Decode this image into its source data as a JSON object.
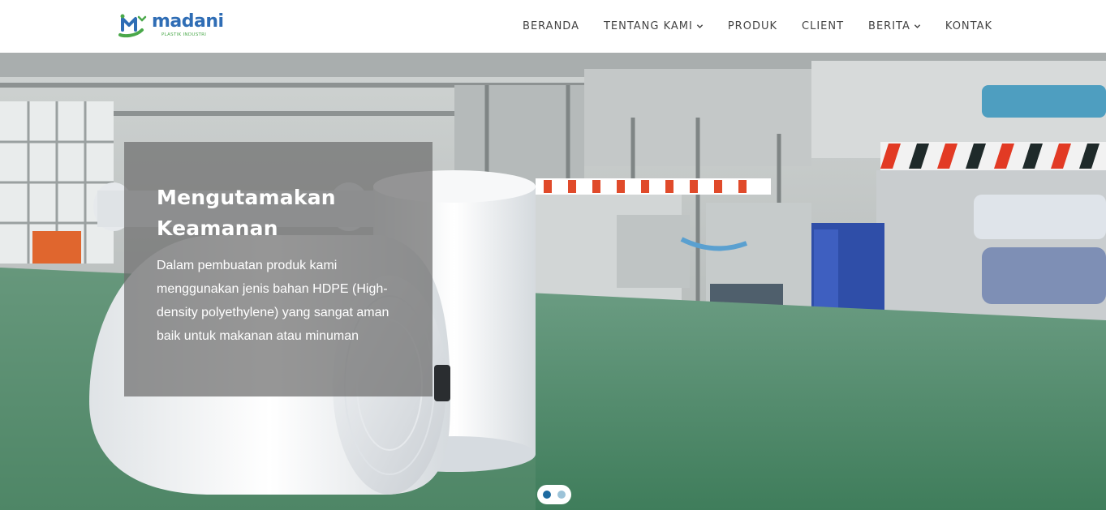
{
  "brand": {
    "name": "madani",
    "tagline": "PLASTIK INDUSTRI",
    "logo_icon": "madani-m-logo-icon",
    "colors": {
      "blue": "#2f6db5",
      "green": "#4aa84a"
    }
  },
  "nav": {
    "items": [
      {
        "label": "BERANDA",
        "dropdown": false
      },
      {
        "label": "TENTANG KAMI",
        "dropdown": true
      },
      {
        "label": "PRODUK",
        "dropdown": false
      },
      {
        "label": "CLIENT",
        "dropdown": false
      },
      {
        "label": "BERITA",
        "dropdown": true
      },
      {
        "label": "KONTAK",
        "dropdown": false
      }
    ]
  },
  "hero": {
    "slide": {
      "title_line1": "Mengutamakan",
      "title_line2": "Keamanan",
      "text": "Dalam pembuatan produk kami menggunakan jenis bahan HDPE (High-density polyethylene) yang sangat aman baik untuk makanan atau minuman"
    },
    "slides_total": 2,
    "active_slide": 1,
    "colors": {
      "dot_active": "#1d6aa0",
      "dot_inactive": "#9cc3d8",
      "floor": "#4e8a6a"
    }
  }
}
